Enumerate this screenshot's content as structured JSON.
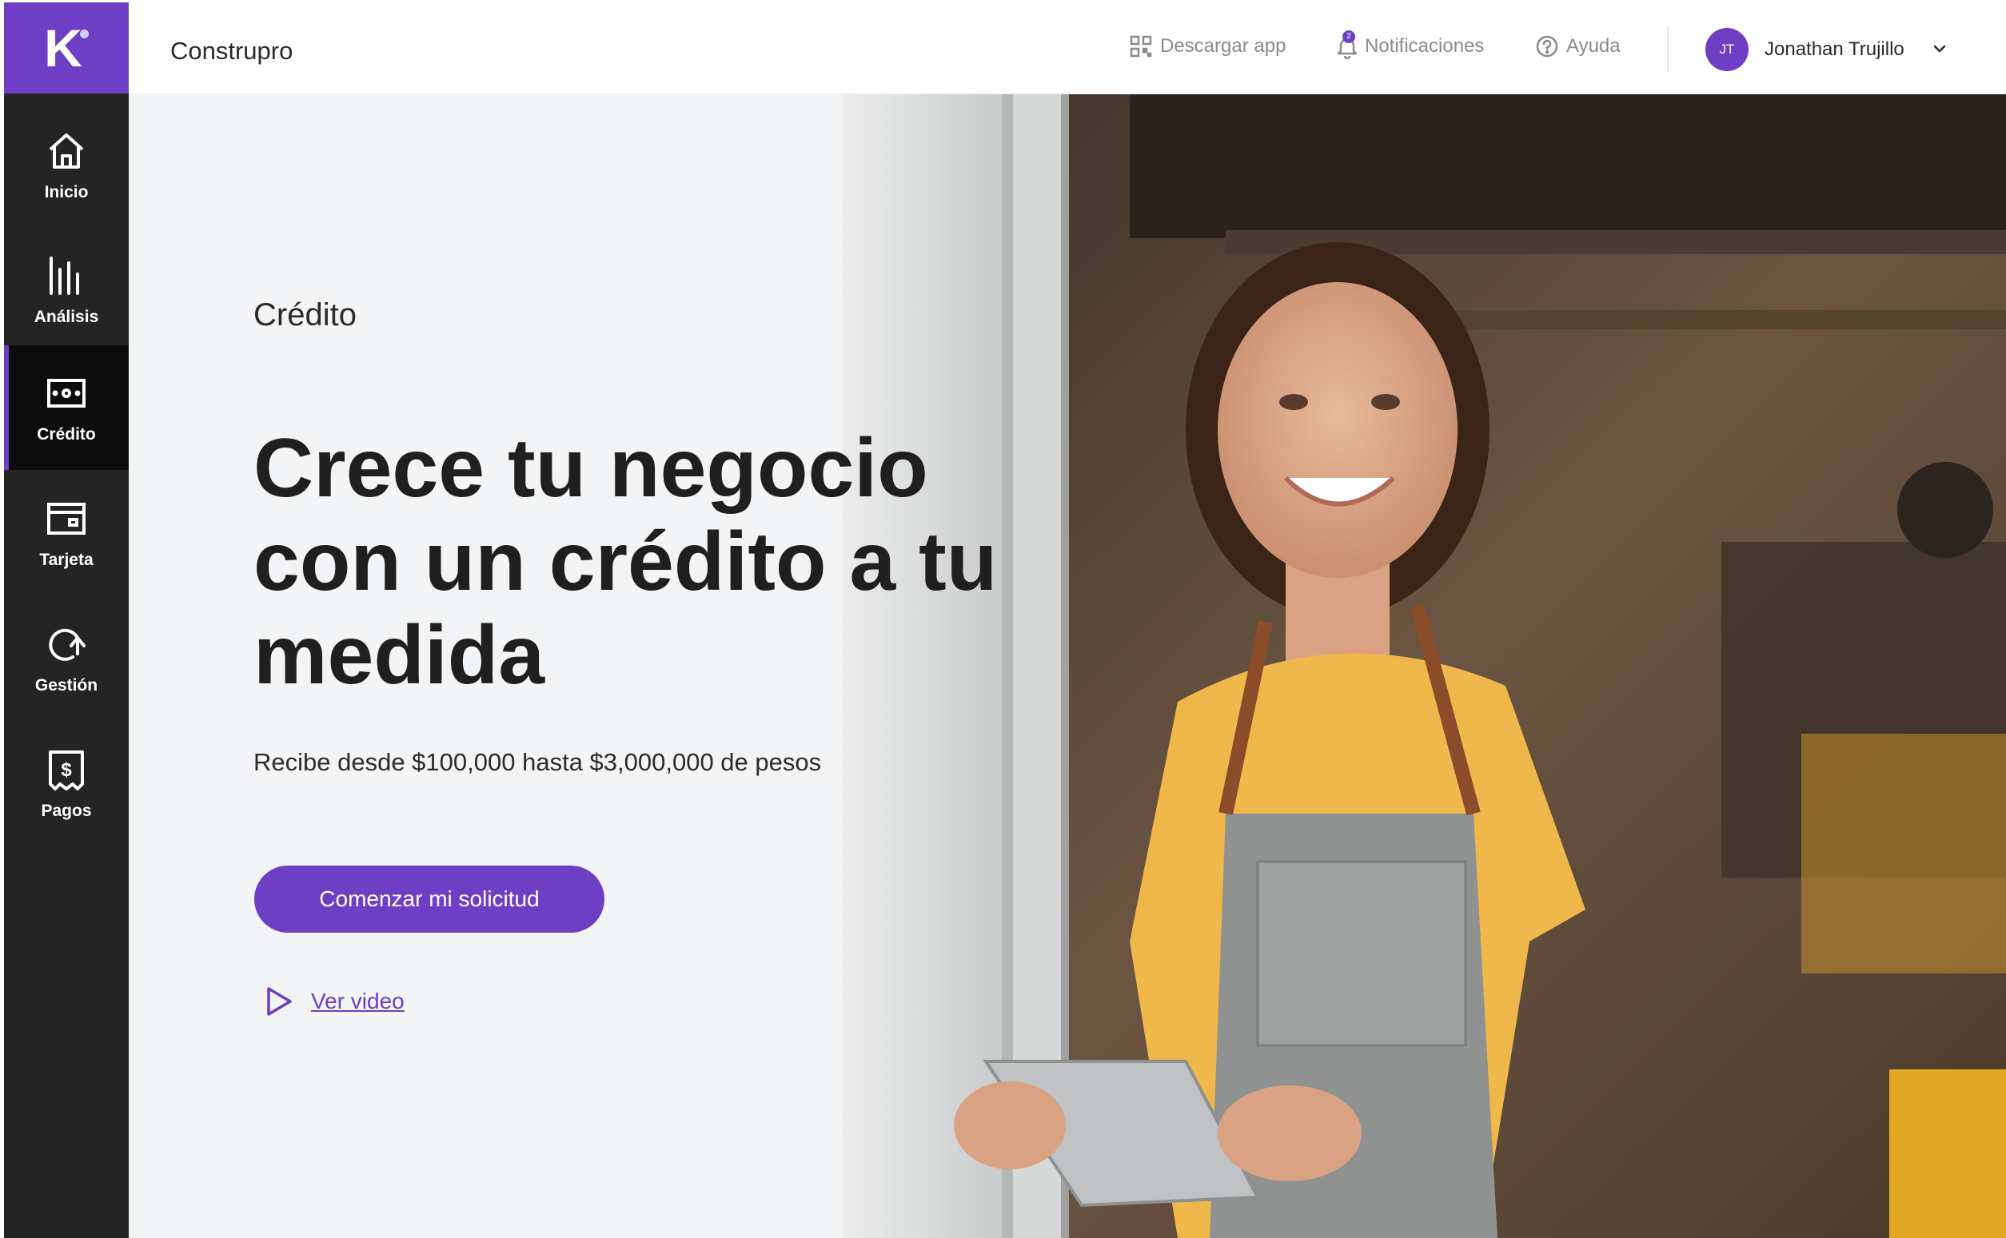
{
  "app": {
    "logo_letter": "K",
    "brand": "Construpro"
  },
  "sidebar": {
    "items": [
      {
        "label": "Inicio",
        "icon": "home-icon"
      },
      {
        "label": "Análisis",
        "icon": "bar-chart-icon"
      },
      {
        "label": "Crédito",
        "icon": "credit-icon",
        "active": true
      },
      {
        "label": "Tarjeta",
        "icon": "card-icon"
      },
      {
        "label": "Gestión",
        "icon": "refresh-arrow-icon"
      },
      {
        "label": "Pagos",
        "icon": "receipt-icon"
      }
    ]
  },
  "topbar": {
    "download_app": "Descargar app",
    "notifications": "Notificaciones",
    "notification_count": "2",
    "help": "Ayuda",
    "user_initials": "JT",
    "user_name": "Jonathan Trujillo"
  },
  "main": {
    "section_label": "Crédito",
    "headline": "Crece tu negocio con un crédito a tu medida",
    "subtitle": "Recibe desde $100,000 hasta $3,000,000 de pesos",
    "cta_label": "Comenzar mi solicitud",
    "video_link": "Ver video"
  },
  "colors": {
    "accent": "#6c3fc4",
    "sidebar_bg": "#242424",
    "sidebar_active_bg": "#0c0c0c",
    "content_bg": "#f3f4f6"
  }
}
